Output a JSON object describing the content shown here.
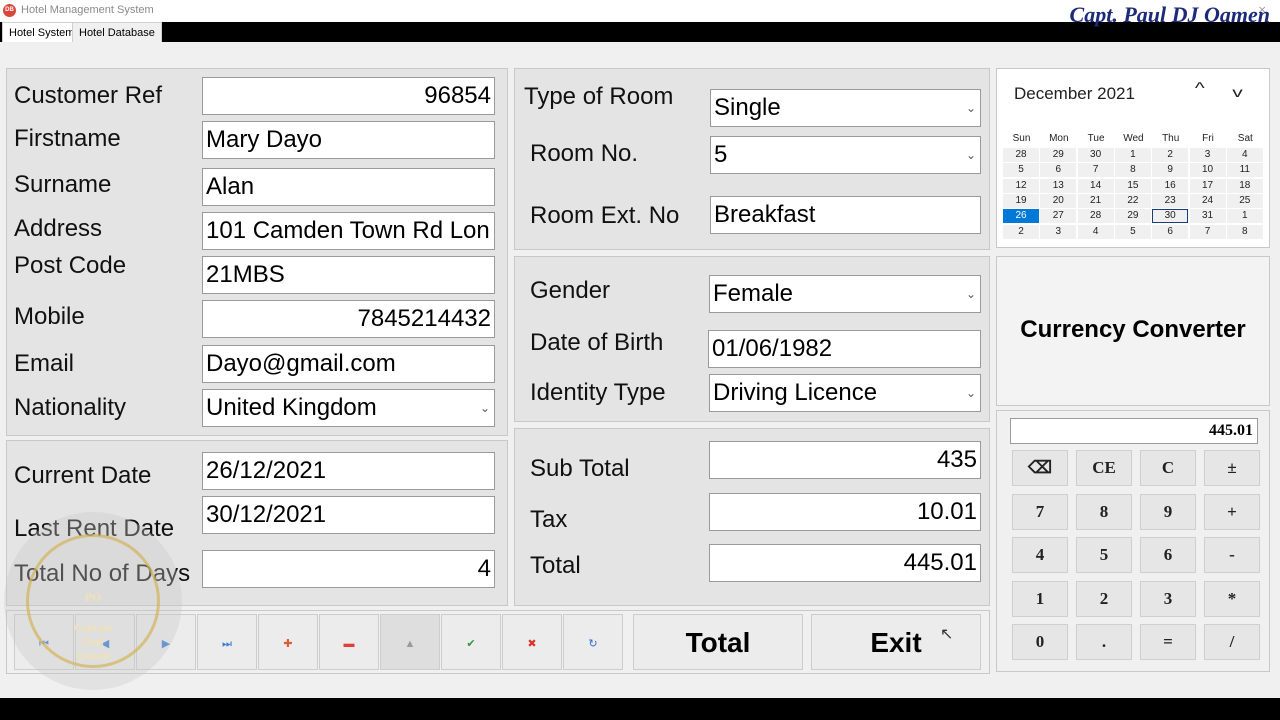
{
  "window": {
    "title": "Hotel Management System",
    "close_glyph": "×",
    "app_icon": "DB"
  },
  "watermark": {
    "author": "Capt. Paul DJ Oamen",
    "logo_text": [
      "PO",
      "Captain",
      "Paul",
      "Oamen"
    ]
  },
  "tabs": [
    "Hotel System",
    "Hotel Database"
  ],
  "customer": {
    "labels": {
      "ref": "Customer Ref",
      "firstname": "Firstname",
      "surname": "Surname",
      "address": "Address",
      "postcode": "Post Code",
      "mobile": "Mobile",
      "email": "Email",
      "nationality": "Nationality"
    },
    "values": {
      "ref": "96854",
      "firstname": "Mary Dayo",
      "surname": "Alan",
      "address": "101 Camden Town Rd Lon",
      "postcode": "21MBS",
      "mobile": "7845214432",
      "email": "Dayo@gmail.com",
      "nationality": "United Kingdom"
    }
  },
  "dates": {
    "labels": {
      "current": "Current Date",
      "last_rent": "Last Rent Date",
      "days": "Total No of Days"
    },
    "values": {
      "current": "26/12/2021",
      "last_rent": "30/12/2021",
      "days": "4"
    }
  },
  "room": {
    "labels": {
      "type": "Type of Room",
      "number": "Room No.",
      "ext": "Room Ext. No"
    },
    "values": {
      "type": "Single",
      "number": "5",
      "ext": "Breakfast"
    }
  },
  "personal": {
    "labels": {
      "gender": "Gender",
      "dob": "Date of Birth",
      "identity": "Identity Type"
    },
    "values": {
      "gender": "Female",
      "dob": "01/06/1982",
      "identity": "Driving Licence"
    }
  },
  "totals": {
    "labels": {
      "subtotal": "Sub Total",
      "tax": "Tax",
      "total": "Total"
    },
    "values": {
      "subtotal": "435",
      "tax": "10.01",
      "total": "445.01"
    }
  },
  "buttons": {
    "total": "Total",
    "exit": "Exit",
    "nav": [
      {
        "name": "first-record-button",
        "icon": "first-icon",
        "glyph": "⏮",
        "color": "#3a7bd5"
      },
      {
        "name": "previous-record-button",
        "icon": "previous-icon",
        "glyph": "◀",
        "color": "#3a7bd5"
      },
      {
        "name": "next-record-button",
        "icon": "next-icon",
        "glyph": "▶",
        "color": "#3a7bd5"
      },
      {
        "name": "last-record-button",
        "icon": "last-icon",
        "glyph": "⏭",
        "color": "#3a7bd5"
      },
      {
        "name": "add-record-button",
        "icon": "plus-icon",
        "glyph": "✚",
        "color": "#e25b2a"
      },
      {
        "name": "delete-record-button",
        "icon": "minus-icon",
        "glyph": "▬",
        "color": "#e0403a"
      },
      {
        "name": "up-button",
        "icon": "up-triangle-icon",
        "glyph": "▲",
        "color": "#9a9a9a"
      },
      {
        "name": "confirm-button",
        "icon": "check-icon",
        "glyph": "✔",
        "color": "#2e9a3a"
      },
      {
        "name": "cancel-button",
        "icon": "cross-icon",
        "glyph": "✖",
        "color": "#d9342b"
      },
      {
        "name": "refresh-button",
        "icon": "refresh-icon",
        "glyph": "↻",
        "color": "#2f6fd0"
      }
    ]
  },
  "calendar": {
    "month_label": "December 2021",
    "days": [
      "Sun",
      "Mon",
      "Tue",
      "Wed",
      "Thu",
      "Fri",
      "Sat"
    ],
    "weeks": [
      [
        "28",
        "29",
        "30",
        "1",
        "2",
        "3",
        "4"
      ],
      [
        "5",
        "6",
        "7",
        "8",
        "9",
        "10",
        "11"
      ],
      [
        "12",
        "13",
        "14",
        "15",
        "16",
        "17",
        "18"
      ],
      [
        "19",
        "20",
        "21",
        "22",
        "23",
        "24",
        "25"
      ],
      [
        "26",
        "27",
        "28",
        "29",
        "30",
        "31",
        "1"
      ],
      [
        "2",
        "3",
        "4",
        "5",
        "6",
        "7",
        "8"
      ]
    ],
    "selected": "26",
    "today": "30",
    "prev_glyph": "^",
    "next_glyph": "v",
    "selected_color": "#0078d7"
  },
  "currency": {
    "title": "Currency Converter"
  },
  "calculator": {
    "display": "445.01",
    "keys": [
      [
        "⌫",
        "CE",
        "C",
        "±"
      ],
      [
        "7",
        "8",
        "9",
        "+"
      ],
      [
        "4",
        "5",
        "6",
        "-"
      ],
      [
        "1",
        "2",
        "3",
        "*"
      ],
      [
        "0",
        ".",
        "=",
        "/"
      ]
    ]
  }
}
